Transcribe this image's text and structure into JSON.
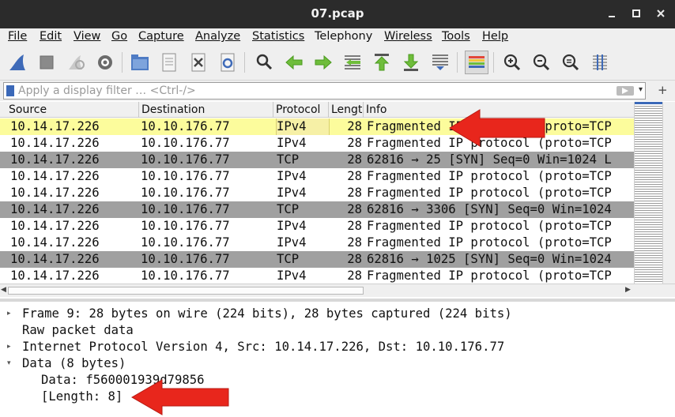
{
  "window": {
    "title": "07.pcap",
    "controls": {
      "minimize": "–",
      "maximize": "▫",
      "close": "×"
    }
  },
  "menu": [
    "File",
    "Edit",
    "View",
    "Go",
    "Capture",
    "Analyze",
    "Statistics",
    "Telephony",
    "Wireless",
    "Tools",
    "Help"
  ],
  "toolbar": {
    "icons": [
      "shark-fin-start-icon",
      "stop-capture-icon",
      "restart-capture-icon",
      "capture-options-icon",
      "open-file-icon",
      "save-file-icon",
      "close-file-icon",
      "reload-file-icon",
      "find-packet-icon",
      "go-back-icon",
      "go-forward-icon",
      "go-to-packet-icon",
      "first-packet-icon",
      "last-packet-icon",
      "autoscroll-icon",
      "colorize-icon",
      "zoom-in-icon",
      "zoom-out-icon",
      "normal-size-icon",
      "resize-columns-icon"
    ]
  },
  "filter": {
    "placeholder": "Apply a display filter … <Ctrl-/>",
    "value": "",
    "dropdown": "▾",
    "add": "+"
  },
  "packet_list": {
    "columns": [
      "Source",
      "Destination",
      "Protocol",
      "Lengt",
      "Info"
    ],
    "rows": [
      {
        "source": "10.14.17.226",
        "destination": "10.10.176.77",
        "protocol": "IPv4",
        "length": "28",
        "info": "Fragmented IP protocol (proto=TCP",
        "style": "selected"
      },
      {
        "source": "10.14.17.226",
        "destination": "10.10.176.77",
        "protocol": "IPv4",
        "length": "28",
        "info": "Fragmented IP protocol (proto=TCP",
        "style": "normal"
      },
      {
        "source": "10.14.17.226",
        "destination": "10.10.176.77",
        "protocol": "TCP",
        "length": "28",
        "info": "62816 → 25 [SYN] Seq=0 Win=1024 L",
        "style": "tcp"
      },
      {
        "source": "10.14.17.226",
        "destination": "10.10.176.77",
        "protocol": "IPv4",
        "length": "28",
        "info": "Fragmented IP protocol (proto=TCP",
        "style": "normal"
      },
      {
        "source": "10.14.17.226",
        "destination": "10.10.176.77",
        "protocol": "IPv4",
        "length": "28",
        "info": "Fragmented IP protocol (proto=TCP",
        "style": "normal"
      },
      {
        "source": "10.14.17.226",
        "destination": "10.10.176.77",
        "protocol": "TCP",
        "length": "28",
        "info": "62816 → 3306 [SYN] Seq=0 Win=1024",
        "style": "tcp"
      },
      {
        "source": "10.14.17.226",
        "destination": "10.10.176.77",
        "protocol": "IPv4",
        "length": "28",
        "info": "Fragmented IP protocol (proto=TCP",
        "style": "normal"
      },
      {
        "source": "10.14.17.226",
        "destination": "10.10.176.77",
        "protocol": "IPv4",
        "length": "28",
        "info": "Fragmented IP protocol (proto=TCP",
        "style": "normal"
      },
      {
        "source": "10.14.17.226",
        "destination": "10.10.176.77",
        "protocol": "TCP",
        "length": "28",
        "info": "62816 → 1025 [SYN] Seq=0 Win=1024",
        "style": "tcp"
      },
      {
        "source": "10.14.17.226",
        "destination": "10.10.176.77",
        "protocol": "IPv4",
        "length": "28",
        "info": "Fragmented IP protocol (proto=TCP",
        "style": "normal"
      }
    ]
  },
  "details": [
    {
      "text": "Frame 9: 28 bytes on wire (224 bits), 28 bytes captured (224 bits)",
      "toggle": "▸",
      "indent": 0
    },
    {
      "text": "Raw packet data",
      "toggle": "",
      "indent": 0
    },
    {
      "text": "Internet Protocol Version 4, Src: 10.14.17.226, Dst: 10.10.176.77",
      "toggle": "▸",
      "indent": 0
    },
    {
      "text": "Data (8 bytes)",
      "toggle": "▾",
      "indent": 0
    },
    {
      "text": "Data: f560001939d79856",
      "toggle": "",
      "indent": 1
    },
    {
      "text": "[Length: 8]",
      "toggle": "",
      "indent": 1
    }
  ],
  "colors": {
    "selected_row": "#fcfc9c",
    "tcp_row": "#a0a0a0",
    "arrow": "#e8261c",
    "titlebar": "#2b2b2b"
  }
}
